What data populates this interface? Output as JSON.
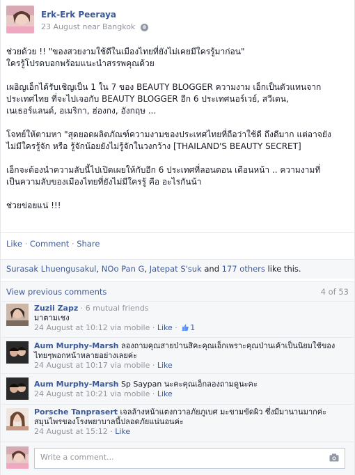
{
  "post": {
    "author": "Erk-Erk Peeraya",
    "meta": "23 August near Bangkok",
    "paragraphs": [
      "ช่วยด้วย !! \"ของสวยงามใช้ดีในเมืองไทยที่ยังไม่เคยมีใครรู้มาก่อน\"\nใครรู้โปรดบอกพร้อมแนะนำสรรพคุณด้วย",
      "เผอิญเอ็กได้รับเชิญเป็น 1 ใน 7 ของ BEAUTY BLOGGER ความงาม เอ็กเป็นตัวแทนจาก\nประเทศไทย ที่จะไปเจอกับ BEAUTY BLOGGER อีก 6 ประเทศนอร์เวย์, สวีเดน,\nเนเธอร์แลนด์, อเมริกา, ฮ่องกง, อังกฤษ ...",
      "โจทย์ให้ตามหา \"สุดยอดผลิตภัณฑ์ความงามของประเทศไทยที่ถือว่าใช้ดี ถึงดีมาก แต่อาจยัง\nไม่มีใครรู้จัก หรือ รู้จักน้อยยังไม่รู้จักในวงกว้าง [THAILAND'S BEAUTY SECRET]",
      "เอ็กจะต้องนำความลับนี้ไปเปิดเผยให้กับอีก 6 ประเทศที่ลอนดอน เดือนหน้า .. ความงามที่\nเป็นความลับของเมืองไทยที่ยังไม่มีใครรู้ คือ อะไรกันน้า",
      "ช่วยข่อยแน่ !!!"
    ]
  },
  "actions": {
    "like": "Like",
    "comment": "Comment",
    "share": "Share",
    "dot": " · "
  },
  "likes": {
    "names": [
      "Surasak Lhuengusakul",
      "NOo Pan G",
      "Jatepat S'suk"
    ],
    "comma": ", ",
    "and": " and ",
    "others": "177 others",
    "suffix": " like this."
  },
  "view_previous": {
    "label": "View previous comments",
    "count": "4 of 53"
  },
  "comments": [
    {
      "name": "Zuzii Zapz",
      "extra": " · 6 mutual friends",
      "text": "มาตามเชง",
      "time": "24 August at 10:12 via mobile",
      "like": "Like",
      "like_count": "1"
    },
    {
      "name": "Aum Murphy-Marsh",
      "text": "ลองถามคุณสายป่านสิคะคุณเอ็กเพราะคุณป่านเค้าเป็นนิยมใช้ของไทยๆพอกหน้าหลายอย่างเลยค่ะ",
      "time": "24 August at 10:17 via mobile",
      "like": "Like"
    },
    {
      "name": "Aum Murphy-Marsh",
      "text": "Sp Saypan นะคะคุณเอ็กลองถามดูนะคะ",
      "time": "24 August at 10:21 via mobile",
      "like": "Like"
    },
    {
      "name": "Porsche Tanprasert",
      "text": "เจลล้างหน้าแตงกวาอภัยภูเบศ มะขามขัดผิว ซึ่งมีมานานมากค่ะ สมุนไพรของโรงพยาบาลนี้ปลอดภัยแน่นอนค่ะ",
      "time": "24 August at 15:12",
      "like": "Like"
    }
  ],
  "write": {
    "placeholder": "Write a comment..."
  },
  "colors": {
    "link": "#3b5998",
    "meta": "#90949c",
    "panel": "#f6f7f9"
  },
  "icons": {
    "privacy": "globe-icon",
    "attach": "camera-icon",
    "like": "thumbs-up-icon"
  }
}
